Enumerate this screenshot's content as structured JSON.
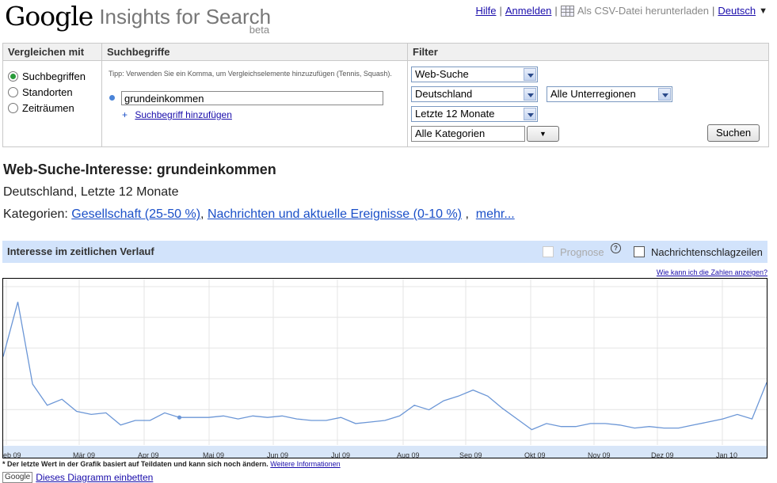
{
  "header": {
    "logo_google": "Google",
    "logo_product": "Insights for Search",
    "logo_beta": "beta",
    "links": {
      "help": "Hilfe",
      "login": "Anmelden",
      "csv": "Als CSV-Datei herunterladen",
      "language": "Deutsch"
    }
  },
  "form": {
    "compare_header": "Vergleichen mit",
    "terms_header": "Suchbegriffe",
    "filter_header": "Filter",
    "compare_options": [
      "Suchbegriffen",
      "Standorten",
      "Zeiträumen"
    ],
    "compare_selected": "Suchbegriffen",
    "tip": "Tipp: Verwenden Sie ein Komma, um Vergleichselemente hinzuzufügen (Tennis, Squash).",
    "term_value": "grundeinkommen",
    "add_term": "Suchbegriff hinzufügen",
    "filters": {
      "search_type": "Web-Suche",
      "country": "Deutschland",
      "subregion": "Alle Unterregionen",
      "time_range": "Letzte 12 Monate",
      "category": "Alle Kategorien"
    },
    "search_button": "Suchen"
  },
  "results": {
    "title": "Web-Suche-Interesse: grundeinkommen",
    "subtitle": "Deutschland, Letzte 12 Monate",
    "categories_label": "Kategorien:",
    "categories": [
      "Gesellschaft (25-50 %)",
      "Nachrichten und aktuelle Ereignisse (0-10 %)"
    ],
    "more": "mehr..."
  },
  "section": {
    "title": "Interesse im zeitlichen Verlauf",
    "prognose": "Prognose",
    "help_mark": "?",
    "news_headlines": "Nachrichtenschlagzeilen",
    "howto_link": "Wie kann ich die Zahlen anzeigen?"
  },
  "chart_data": {
    "type": "line",
    "x_labels": [
      "eb 09",
      "Mär 09",
      "Apr 09",
      "Mai 09",
      "Jun 09",
      "Jul 09",
      "Aug 09",
      "Sep 09",
      "Okt 09",
      "Nov 09",
      "Dez 09",
      "Jan 10",
      "F"
    ],
    "ylim": [
      0,
      100
    ],
    "series": [
      {
        "values": [
          55,
          91,
          37,
          23,
          27,
          19,
          17,
          18,
          10,
          13,
          13,
          18,
          15,
          15,
          15,
          16,
          14,
          16,
          15,
          16,
          14,
          13,
          13,
          15,
          11,
          12,
          13,
          16,
          23,
          20,
          26,
          29,
          33,
          29,
          21,
          14,
          7,
          11,
          9,
          9,
          11,
          11,
          10,
          8,
          9,
          8,
          8,
          10,
          12,
          14,
          17,
          14,
          38
        ],
        "marked_index": 12
      }
    ],
    "color": "#6b96d6",
    "grid": true
  },
  "footnote": {
    "text": "* Der letzte Wert in der Grafik basiert auf Teildaten und kann sich noch ändern.",
    "link": "Weitere Informationen"
  },
  "embed": {
    "badge": "Google",
    "text": "Dieses Diagramm einbetten"
  }
}
